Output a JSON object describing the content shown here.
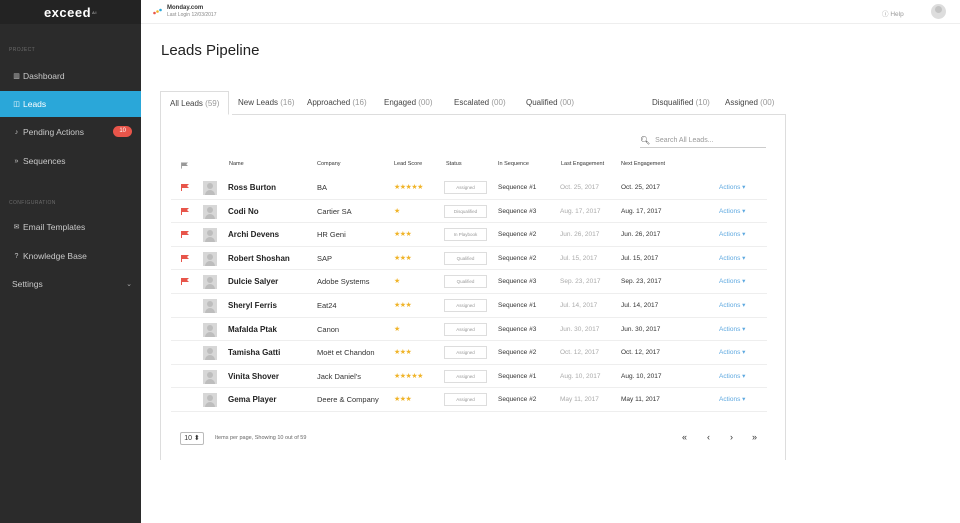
{
  "app": {
    "logo": "exceed",
    "logo_sup": "AI"
  },
  "company": {
    "name": "Monday.com",
    "last_login": "Last Login 12/03/2017"
  },
  "topbar": {
    "help": "Help"
  },
  "sidebar": {
    "section_project": "PROJECT",
    "section_config": "CONFIGURATION",
    "items": [
      {
        "label": "Dashboard",
        "icon": "bar-chart-icon"
      },
      {
        "label": "Leads",
        "icon": "columns-icon"
      },
      {
        "label": "Pending Actions",
        "icon": "bell-icon",
        "badge": "10"
      },
      {
        "label": "Sequences",
        "icon": "forward-icon"
      },
      {
        "label": "Email Templates",
        "icon": "envelope-icon"
      },
      {
        "label": "Knowledge Base",
        "icon": "question-circle-icon"
      },
      {
        "label": "Settings",
        "icon": "chevron-down-icon"
      }
    ]
  },
  "page": {
    "title": "Leads Pipeline"
  },
  "tabs": [
    {
      "label": "All Leads",
      "count": "(59)"
    },
    {
      "label": "New Leads",
      "count": "(16)"
    },
    {
      "label": "Approached",
      "count": "(16)"
    },
    {
      "label": "Engaged",
      "count": "(00)"
    },
    {
      "label": "Escalated",
      "count": "(00)"
    },
    {
      "label": "Qualified",
      "count": "(00)"
    },
    {
      "label": "Disqualified",
      "count": "(10)"
    },
    {
      "label": "Assigned",
      "count": "(00)"
    }
  ],
  "search": {
    "placeholder": "Search All Leads..."
  },
  "table": {
    "headers": [
      "Name",
      "Company",
      "Lead Score",
      "Status",
      "In Sequence",
      "Last Engagement",
      "Next Engagement"
    ],
    "rows": [
      {
        "flagged": true,
        "name": "Ross Burton",
        "company": "BA",
        "stars": "★★★★★",
        "status": "Assigned",
        "sequence": "Sequence #1",
        "last": "Oct. 25, 2017",
        "next": "Oct. 25, 2017",
        "action": "Actions ▾"
      },
      {
        "flagged": true,
        "name": "Codi No",
        "company": "Cartier SA",
        "stars": "★",
        "status": "Disqualified",
        "sequence": "Sequence #3",
        "last": "Aug. 17, 2017",
        "next": "Aug. 17, 2017",
        "action": "Actions ▾"
      },
      {
        "flagged": true,
        "name": "Archi Devens",
        "company": "HR Geni",
        "stars": "★★★",
        "status": "In Playbook",
        "sequence": "Sequence #2",
        "last": "Jun. 26, 2017",
        "next": "Jun. 26, 2017",
        "action": "Actions ▾"
      },
      {
        "flagged": true,
        "name": "Robert Shoshan",
        "company": "SAP",
        "stars": "★★★",
        "status": "Qualified",
        "sequence": "Sequence #2",
        "last": "Jul. 15, 2017",
        "next": "Jul. 15, 2017",
        "action": "Actions ▾"
      },
      {
        "flagged": true,
        "name": "Dulcie Salyer",
        "company": "Adobe Systems",
        "stars": "★",
        "status": "Qualified",
        "sequence": "Sequence #3",
        "last": "Sep. 23, 2017",
        "next": "Sep. 23, 2017",
        "action": "Actions ▾"
      },
      {
        "flagged": false,
        "name": "Sheryl Ferris",
        "company": "Eat24",
        "stars": "★★★",
        "status": "Assigned",
        "sequence": "Sequence #1",
        "last": "Jul. 14, 2017",
        "next": "Jul. 14, 2017",
        "action": "Actions ▾"
      },
      {
        "flagged": false,
        "name": "Mafalda Ptak",
        "company": "Canon",
        "stars": "★",
        "status": "Assigned",
        "sequence": "Sequence #3",
        "last": "Jun. 30, 2017",
        "next": "Jun. 30, 2017",
        "action": "Actions ▾"
      },
      {
        "flagged": false,
        "name": "Tamisha Gatti",
        "company": "Moët et Chandon",
        "stars": "★★★",
        "status": "Assigned",
        "sequence": "Sequence #2",
        "last": "Oct. 12, 2017",
        "next": "Oct. 12, 2017",
        "action": "Actions ▾"
      },
      {
        "flagged": false,
        "name": "Vinita Shover",
        "company": "Jack Daniel's",
        "stars": "★★★★★",
        "status": "Assigned",
        "sequence": "Sequence #1",
        "last": "Aug. 10, 2017",
        "next": "Aug. 10, 2017",
        "action": "Actions ▾"
      },
      {
        "flagged": false,
        "name": "Gema Player",
        "company": "Deere & Company",
        "stars": "★★★",
        "status": "Assigned",
        "sequence": "Sequence #2",
        "last": "May 11, 2017",
        "next": "May 11, 2017",
        "action": "Actions ▾"
      }
    ]
  },
  "pagination": {
    "per_page": "10 ⬍",
    "info": "Items per page, Showing 10 out of 59",
    "first": "«",
    "prev": "‹",
    "next": "›",
    "last": "»"
  },
  "colors": {
    "sidebar": "#2b2b2b",
    "accent": "#2aa7d9",
    "flag": "#e8554a",
    "star": "#f0b429",
    "link": "#5fa9e0"
  }
}
